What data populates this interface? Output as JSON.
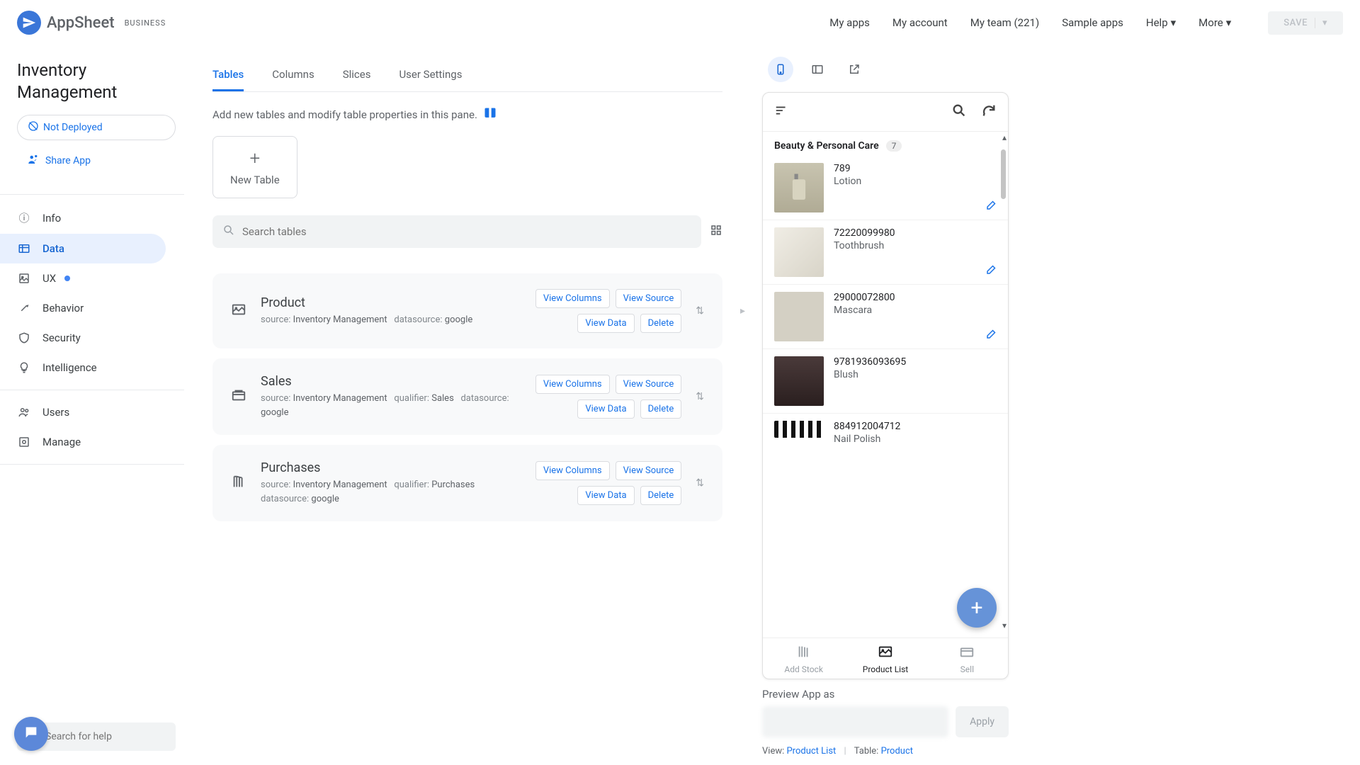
{
  "header": {
    "logo_text": "AppSheet",
    "badge": "BUSINESS",
    "nav": {
      "my_apps": "My apps",
      "my_account": "My account",
      "my_team": "My team (221)",
      "sample_apps": "Sample apps",
      "help": "Help",
      "more": "More"
    },
    "save": "SAVE"
  },
  "sidebar": {
    "app_title": "Inventory Management",
    "not_deployed": "Not Deployed",
    "share_app": "Share App",
    "nav": {
      "info": "Info",
      "data": "Data",
      "ux": "UX",
      "behavior": "Behavior",
      "security": "Security",
      "intelligence": "Intelligence",
      "users": "Users",
      "manage": "Manage"
    },
    "help_placeholder": "Search for help"
  },
  "content": {
    "tabs": {
      "tables": "Tables",
      "columns": "Columns",
      "slices": "Slices",
      "user_settings": "User Settings"
    },
    "pane_desc": "Add new tables and modify table properties in this pane.",
    "new_table": "New Table",
    "search_placeholder": "Search tables",
    "actions": {
      "view_columns": "View Columns",
      "view_source": "View Source",
      "view_data": "View Data",
      "delete": "Delete"
    },
    "meta_labels": {
      "source": "source:",
      "datasource": "datasource:",
      "qualifier": "qualifier:"
    },
    "tables": [
      {
        "name": "Product",
        "source": "Inventory Management",
        "qualifier": "",
        "datasource": "google"
      },
      {
        "name": "Sales",
        "source": "Inventory Management",
        "qualifier": "Sales",
        "datasource": "google"
      },
      {
        "name": "Purchases",
        "source": "Inventory Management",
        "qualifier": "Purchases",
        "datasource": "google"
      }
    ]
  },
  "preview": {
    "category_name": "Beauty & Personal Care",
    "category_count": "7",
    "products": [
      {
        "sku": "789",
        "name": "Lotion"
      },
      {
        "sku": "72220099980",
        "name": "Toothbrush"
      },
      {
        "sku": "29000072800",
        "name": "Mascara"
      },
      {
        "sku": "9781936093695",
        "name": "Blush"
      },
      {
        "sku": "884912004712",
        "name": "Nail Polish"
      }
    ],
    "bottom_nav": {
      "add_stock": "Add Stock",
      "product_list": "Product List",
      "sell": "Sell"
    },
    "footer": {
      "preview_as": "Preview App as",
      "apply": "Apply",
      "view_label": "View:",
      "view_value": "Product List",
      "table_label": "Table:",
      "table_value": "Product"
    }
  }
}
